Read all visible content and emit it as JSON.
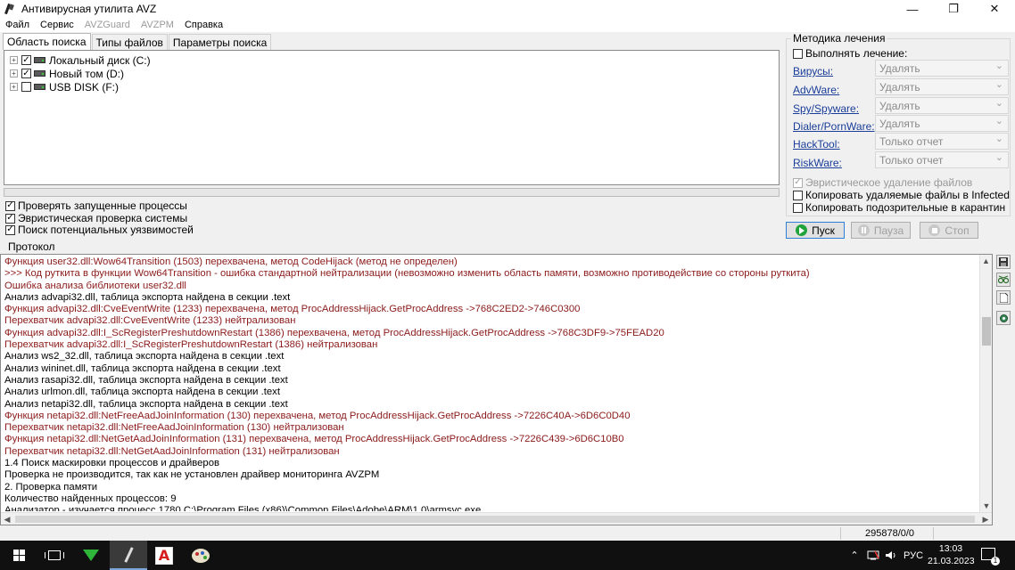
{
  "window": {
    "title": "Антивирусная утилита AVZ",
    "controls": {
      "minimize": "—",
      "maximize": "❐",
      "close": "✕"
    }
  },
  "menu": [
    {
      "label": "Файл",
      "enabled": true
    },
    {
      "label": "Сервис",
      "enabled": true
    },
    {
      "label": "AVZGuard",
      "enabled": false
    },
    {
      "label": "AVZPM",
      "enabled": false
    },
    {
      "label": "Справка",
      "enabled": true
    }
  ],
  "tabs": [
    "Область поиска",
    "Типы файлов",
    "Параметры поиска"
  ],
  "drives": [
    {
      "label": "Локальный диск (C:)",
      "checked": true
    },
    {
      "label": "Новый том (D:)",
      "checked": true
    },
    {
      "label": "USB DISK (F:)",
      "checked": false
    }
  ],
  "options": [
    {
      "label": "Проверять запущенные процессы",
      "checked": true
    },
    {
      "label": "Эвристическая проверка системы",
      "checked": true
    },
    {
      "label": "Поиск потенциальных уязвимостей",
      "checked": true
    }
  ],
  "cure": {
    "title": "Методика лечения",
    "perform_label": "Выполнять лечение:",
    "rows": [
      {
        "label": "Вирусы:",
        "value": "Удалять"
      },
      {
        "label": "AdvWare:",
        "value": "Удалять"
      },
      {
        "label": "Spy/Spyware:",
        "value": "Удалять"
      },
      {
        "label": "Dialer/PornWare:",
        "value": "Удалять"
      },
      {
        "label": "HackTool:",
        "value": "Только отчет"
      },
      {
        "label": "RiskWare:",
        "value": "Только отчет"
      }
    ],
    "heuristic_delete": "Эвристическое удаление файлов",
    "copy_deleted": "Копировать удаляемые файлы в  Infected",
    "copy_suspicious": "Копировать подозрительные в  карантин"
  },
  "buttons": {
    "start": "Пуск",
    "pause": "Пауза",
    "stop": "Стоп"
  },
  "protocol": {
    "label": "Протокол",
    "lines": [
      {
        "text": "Функция user32.dll:Wow64Transition (1503) перехвачена, метод CodeHijack (метод не определен)",
        "color": "#8b1a1a"
      },
      {
        "text": " >>> Код руткита в функции Wow64Transition - ошибка стандартной нейтрализации (невозможно изменить область памяти, возможно противодействие со стороны руткита)",
        "color": "#8b1a1a"
      },
      {
        "text": "Ошибка анализа библиотеки user32.dll",
        "color": "#8b1a1a"
      },
      {
        "text": " Анализ advapi32.dll, таблица экспорта найдена в секции .text",
        "color": "#000000"
      },
      {
        "text": "Функция advapi32.dll:CveEventWrite (1233) перехвачена, метод ProcAddressHijack.GetProcAddress ->768C2ED2->746C0300",
        "color": "#8b1a1a"
      },
      {
        "text": "Перехватчик advapi32.dll:CveEventWrite (1233) нейтрализован",
        "color": "#8b1a1a"
      },
      {
        "text": "Функция advapi32.dll:I_ScRegisterPreshutdownRestart (1386) перехвачена, метод ProcAddressHijack.GetProcAddress ->768C3DF9->75FEAD20",
        "color": "#8b1a1a"
      },
      {
        "text": "Перехватчик advapi32.dll:I_ScRegisterPreshutdownRestart (1386) нейтрализован",
        "color": "#8b1a1a"
      },
      {
        "text": " Анализ ws2_32.dll, таблица экспорта найдена в секции .text",
        "color": "#000000"
      },
      {
        "text": " Анализ wininet.dll, таблица экспорта найдена в секции .text",
        "color": "#000000"
      },
      {
        "text": " Анализ rasapi32.dll, таблица экспорта найдена в секции .text",
        "color": "#000000"
      },
      {
        "text": " Анализ urlmon.dll, таблица экспорта найдена в секции .text",
        "color": "#000000"
      },
      {
        "text": " Анализ netapi32.dll, таблица экспорта найдена в секции .text",
        "color": "#000000"
      },
      {
        "text": "Функция netapi32.dll:NetFreeAadJoinInformation (130) перехвачена, метод ProcAddressHijack.GetProcAddress ->7226C40A->6D6C0D40",
        "color": "#8b1a1a"
      },
      {
        "text": "Перехватчик netapi32.dll:NetFreeAadJoinInformation (130) нейтрализован",
        "color": "#8b1a1a"
      },
      {
        "text": "Функция netapi32.dll:NetGetAadJoinInformation (131) перехвачена, метод ProcAddressHijack.GetProcAddress ->7226C439->6D6C10B0",
        "color": "#8b1a1a"
      },
      {
        "text": "Перехватчик netapi32.dll:NetGetAadJoinInformation (131) нейтрализован",
        "color": "#8b1a1a"
      },
      {
        "text": "1.4 Поиск маскировки процессов и драйверов",
        "color": "#000000"
      },
      {
        "text": " Проверка не производится, так как не установлен драйвер мониторинга AVZPM",
        "color": "#000000"
      },
      {
        "text": "2. Проверка памяти",
        "color": "#000000"
      },
      {
        "text": " Количество найденных процессов: 9",
        "color": "#000000"
      },
      {
        "text": "Анализатор - изучается процесс 1780 C:\\Program Files (x86)\\Common Files\\Adobe\\ARM\\1.0\\armsvc.exe",
        "color": "#000000"
      }
    ]
  },
  "status": {
    "counter": "295878/0/0"
  },
  "taskbar": {
    "language": "РУС",
    "time": "13:03",
    "date": "21.03.2023",
    "notification_count": "1",
    "acrobat_glyph": "A"
  },
  "colors": {
    "link": "#1a3d9a",
    "log_warning": "#8b1a1a",
    "start_icon": "#1fa33a"
  }
}
